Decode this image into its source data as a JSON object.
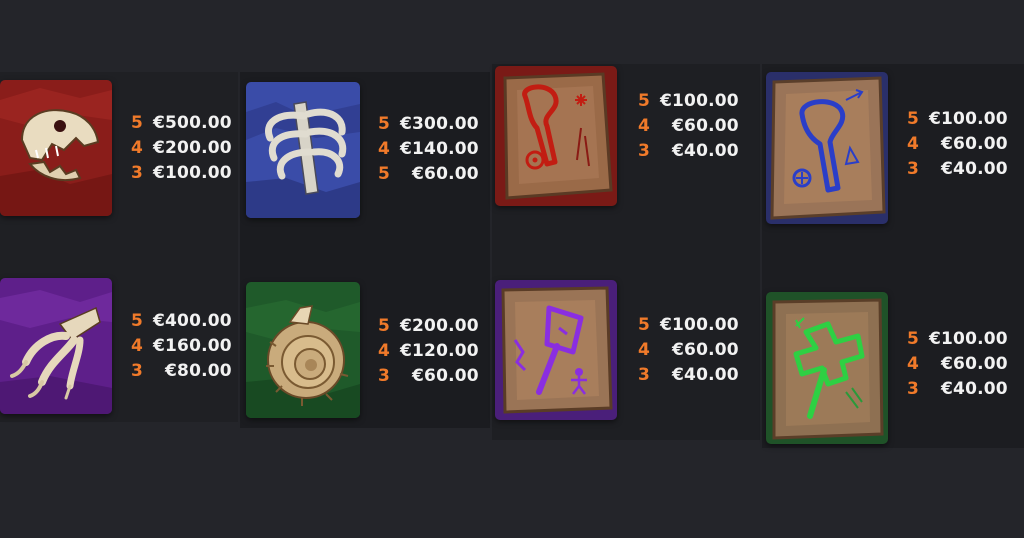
{
  "symbols": [
    {
      "name": "T-Rex Skull",
      "pays": [
        {
          "count": "5",
          "value": "€500.00"
        },
        {
          "count": "4",
          "value": "€200.00"
        },
        {
          "count": "3",
          "value": "€100.00"
        }
      ]
    },
    {
      "name": "Ribcage",
      "pays": [
        {
          "count": "5",
          "value": "€300.00"
        },
        {
          "count": "4",
          "value": "€140.00"
        },
        {
          "count": "5",
          "value": "€60.00"
        }
      ]
    },
    {
      "name": "Red Rune Stone",
      "pays": [
        {
          "count": "5",
          "value": "€100.00"
        },
        {
          "count": "4",
          "value": "€60.00"
        },
        {
          "count": "3",
          "value": "€40.00"
        }
      ]
    },
    {
      "name": "Blue Rune Stone",
      "pays": [
        {
          "count": "5",
          "value": "€100.00"
        },
        {
          "count": "4",
          "value": "€60.00"
        },
        {
          "count": "3",
          "value": "€40.00"
        }
      ]
    },
    {
      "name": "Claw",
      "pays": [
        {
          "count": "5",
          "value": "€400.00"
        },
        {
          "count": "4",
          "value": "€160.00"
        },
        {
          "count": "3",
          "value": "€80.00"
        }
      ]
    },
    {
      "name": "Ammonite",
      "pays": [
        {
          "count": "5",
          "value": "€200.00"
        },
        {
          "count": "4",
          "value": "€120.00"
        },
        {
          "count": "3",
          "value": "€60.00"
        }
      ]
    },
    {
      "name": "Purple Rune Stone",
      "pays": [
        {
          "count": "5",
          "value": "€100.00"
        },
        {
          "count": "4",
          "value": "€60.00"
        },
        {
          "count": "3",
          "value": "€40.00"
        }
      ]
    },
    {
      "name": "Green Rune Stone",
      "pays": [
        {
          "count": "5",
          "value": "€100.00"
        },
        {
          "count": "4",
          "value": "€60.00"
        },
        {
          "count": "3",
          "value": "€40.00"
        }
      ]
    }
  ],
  "colors": {
    "count": "#f07a2a",
    "value": "#f2f2f2",
    "background": "#24252a"
  },
  "icons": [
    "t-rex-skull-icon",
    "ribcage-icon",
    "red-rune-stone-icon",
    "blue-rune-stone-icon",
    "claw-icon",
    "ammonite-icon",
    "purple-rune-stone-icon",
    "green-rune-stone-icon"
  ]
}
